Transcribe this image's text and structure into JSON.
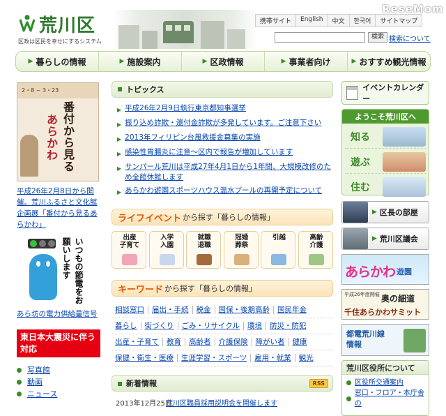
{
  "header": {
    "logo_title": "荒川区",
    "logo_tagline": "区政は区民を幸せにするシステム",
    "brand": "ReseMom",
    "utility_links": [
      "携帯サイト",
      "English",
      "中文",
      "한국어",
      "サイトマップ"
    ],
    "search_placeholder": "",
    "search_button": "検索",
    "search_help": "検索について"
  },
  "global_nav": [
    "暮らしの情報",
    "施設案内",
    "区政情報",
    "事業者向け",
    "おすすめ観光情報"
  ],
  "left": {
    "poster_date": "2・8 ~ 3・23",
    "poster_title_1": "番付から見る",
    "poster_title_2": "あらかわ",
    "poster_caption": "平成26年2月8日から開催。荒川ふるさと文化館企画展「番付から見るあらかわ」",
    "mascot_text": "いつもの節電をお願いします",
    "mascot_caption": "あら坊の電力供給量信号",
    "quake_banner": "東日本大震災に伴う対応",
    "nav": [
      "写真館",
      "動画",
      "ニュース"
    ]
  },
  "topics": {
    "title": "トピックス",
    "items": [
      "平成26年2月9日執行東京都知事選挙",
      "振り込め詐欺・還付金詐欺が多発しています。ご注意下さい",
      "2013年フィリピン台風救援金募集の実施",
      "感染性胃腸炎に注意～区内で報告が増加しています",
      "サンパール荒川は平成27年4月1日から1年間、大規模改修のため全館休館します",
      "あらかわ遊園スポーツハウス温水プールの再開予定について"
    ]
  },
  "life_events": {
    "heading": "ライフイベント",
    "subheading": "から探す「暮らしの情報」",
    "items": [
      "出産\n子育て",
      "入学\n入園",
      "就職\n退職",
      "冠婚\n葬祭",
      "引越",
      "高齢\n介護"
    ]
  },
  "keywords": {
    "heading": "キーワード",
    "subheading": "から探す「暮らしの情報」",
    "rows": [
      [
        "相談窓口",
        "届出・手続",
        "税金",
        "国保・後期高齢",
        "国民年金"
      ],
      [
        "暮らし",
        "街づくり",
        "ごみ・リサイクル",
        "環境",
        "防災・防犯"
      ],
      [
        "出産・子育て",
        "教育",
        "高齢者",
        "介護保険",
        "障がい者",
        "健康"
      ],
      [
        "保健・衛生・医療",
        "生涯学習・スポーツ",
        "雇用・就業",
        "観光"
      ]
    ]
  },
  "news": {
    "title": "新着情報",
    "rss": "RSS",
    "date": "2013年12月25日",
    "item": "荒川区職員採用説明会を開催します"
  },
  "right": {
    "event_calendar": "イベントカレンダー",
    "welcome_title": "ようこそ荒川区へ",
    "welcome_rows": [
      "知る",
      "遊ぶ",
      "住む"
    ],
    "mayor_room": "区長の部屋",
    "assembly": "荒川区議会",
    "banner_yuen_1": "あらかわ",
    "banner_yuen_2": "遊園",
    "banner_summit_small": "平成26年度開催",
    "banner_summit_title": "奥の細道",
    "banner_summit_sub": "千住あらかわサミット",
    "banner_toden": "都電荒川線\n情報",
    "office_title": "荒川区役所について",
    "office_links": [
      "区役所交通案内",
      "窓口・フロア・本庁舎の"
    ]
  }
}
